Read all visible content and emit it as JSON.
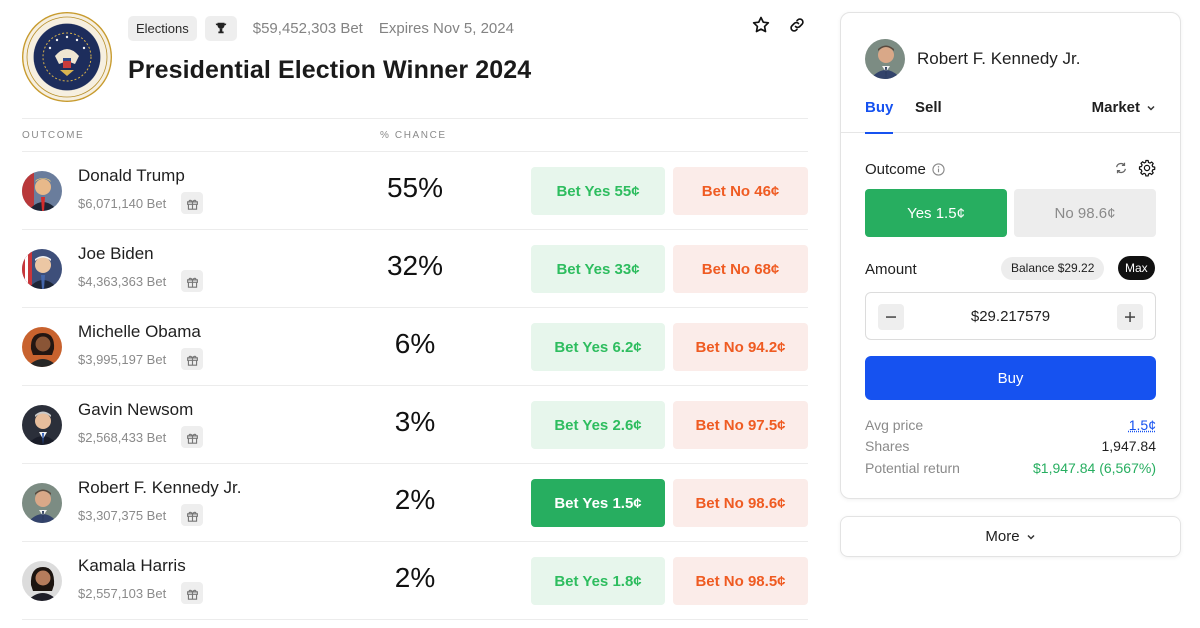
{
  "header": {
    "tag": "Elections",
    "volume": "$59,452,303 Bet",
    "expires": "Expires Nov 5, 2024",
    "title": "Presidential Election Winner 2024"
  },
  "table": {
    "col_outcome": "OUTCOME",
    "col_chance": "% CHANCE",
    "rows": [
      {
        "name": "Donald Trump",
        "volume": "$6,071,140 Bet",
        "chance": "55%",
        "yes": "Bet Yes 55¢",
        "no": "Bet No 46¢"
      },
      {
        "name": "Joe Biden",
        "volume": "$4,363,363 Bet",
        "chance": "32%",
        "yes": "Bet Yes 33¢",
        "no": "Bet No 68¢"
      },
      {
        "name": "Michelle Obama",
        "volume": "$3,995,197 Bet",
        "chance": "6%",
        "yes": "Bet Yes 6.2¢",
        "no": "Bet No 94.2¢"
      },
      {
        "name": "Gavin Newsom",
        "volume": "$2,568,433 Bet",
        "chance": "3%",
        "yes": "Bet Yes 2.6¢",
        "no": "Bet No 97.5¢"
      },
      {
        "name": "Robert F. Kennedy Jr.",
        "volume": "$3,307,375 Bet",
        "chance": "2%",
        "yes": "Bet Yes 1.5¢",
        "no": "Bet No 98.6¢"
      },
      {
        "name": "Kamala Harris",
        "volume": "$2,557,103 Bet",
        "chance": "2%",
        "yes": "Bet Yes 1.8¢",
        "no": "Bet No 98.5¢"
      }
    ]
  },
  "panel": {
    "candidate": "Robert F. Kennedy Jr.",
    "tab_buy": "Buy",
    "tab_sell": "Sell",
    "order_type": "Market",
    "outcome_label": "Outcome",
    "option_yes": "Yes 1.5¢",
    "option_no": "No 98.6¢",
    "amount_label": "Amount",
    "balance": "Balance $29.22",
    "max": "Max",
    "amount_value": "$29.217579",
    "buy_button": "Buy",
    "avg_price_label": "Avg price",
    "avg_price": "1.5¢",
    "shares_label": "Shares",
    "shares": "1,947.84",
    "return_label": "Potential return",
    "return": "$1,947.84 (6,567%)"
  },
  "more_button": "More",
  "colors": {
    "accent_blue": "#1652f0",
    "yes_green": "#27ae60",
    "no_orange": "#ef5b22"
  }
}
